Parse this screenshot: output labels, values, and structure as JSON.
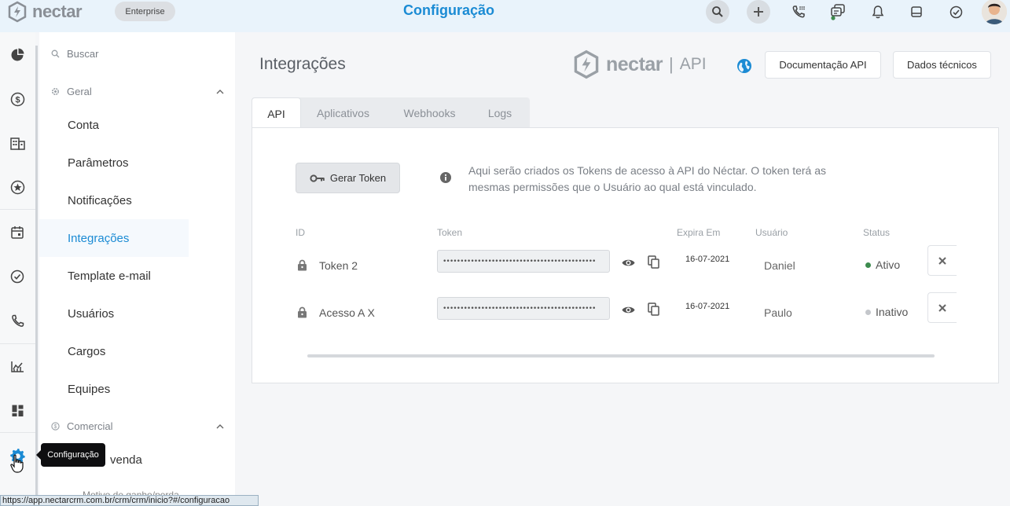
{
  "topbar": {
    "logo_text": "nectar",
    "plan_badge": "Enterprise",
    "page_title": "Configuração",
    "icons": [
      "search-icon",
      "plus-icon",
      "phone-dial-icon",
      "chat-stack-icon",
      "bell-icon",
      "inbox-icon",
      "check-circle-icon",
      "user-avatar"
    ]
  },
  "rail": {
    "icons": [
      "pie-chart-icon",
      "dollar-icon",
      "building-icon",
      "star-icon",
      "calendar-icon",
      "check-circle-icon",
      "phone-icon",
      "chart-line-icon",
      "dashboard-icon",
      "gear-icon"
    ],
    "active_icon": "gear-icon",
    "active_color": "#1b8bd4"
  },
  "menu": {
    "search_placeholder": "Buscar",
    "group_general": "Geral",
    "items": [
      "Conta",
      "Parâmetros",
      "Notificações",
      "Integrações",
      "Template e-mail",
      "Usuários",
      "Cargos",
      "Equipes"
    ],
    "active_item": "Integrações",
    "group_commercial": "Comercial",
    "after_tooltip_item": "venda",
    "cut_item": "Motivo de ganho/perda"
  },
  "main": {
    "title": "Integrações",
    "brand_word": "nectar",
    "brand_separator": "|",
    "brand_api": "API",
    "btn_docs": "Documentação API",
    "btn_tech": "Dados técnicos",
    "tabs": [
      "API",
      "Aplicativos",
      "Webhooks",
      "Logs"
    ],
    "active_tab": "API",
    "gen_token_label": "Gerar Token",
    "info_text": "Aqui serão criados os Tokens de acesso à API do Néctar. O token terá as mesmas permissões que o Usuário ao qual está vinculado.",
    "table": {
      "headers": [
        "ID",
        "Token",
        "Expira Em",
        "Usuário",
        "Status"
      ],
      "rows": [
        {
          "id": "Token 2",
          "token": "••••••••••••••••••••••••••••••••••••••••••••",
          "expires": "16-07-2021",
          "user": "Daniel",
          "status": "Ativo",
          "status_color": "#3d8b4e"
        },
        {
          "id": "Acesso A X",
          "token": "••••••••••••••••••••••••••••••••••••••••••••",
          "expires": "16-07-2021",
          "user": "Paulo",
          "status": "Inativo",
          "status_color": "#c4c7cb"
        }
      ]
    }
  },
  "tooltip": "Configuração",
  "statusbar_url": "https://app.nectarcrm.com.br/crm/crm/inicio?#/configuracao",
  "colors": {
    "accent": "#1b8bd4",
    "topbar_bg": "#e9f3fb"
  }
}
